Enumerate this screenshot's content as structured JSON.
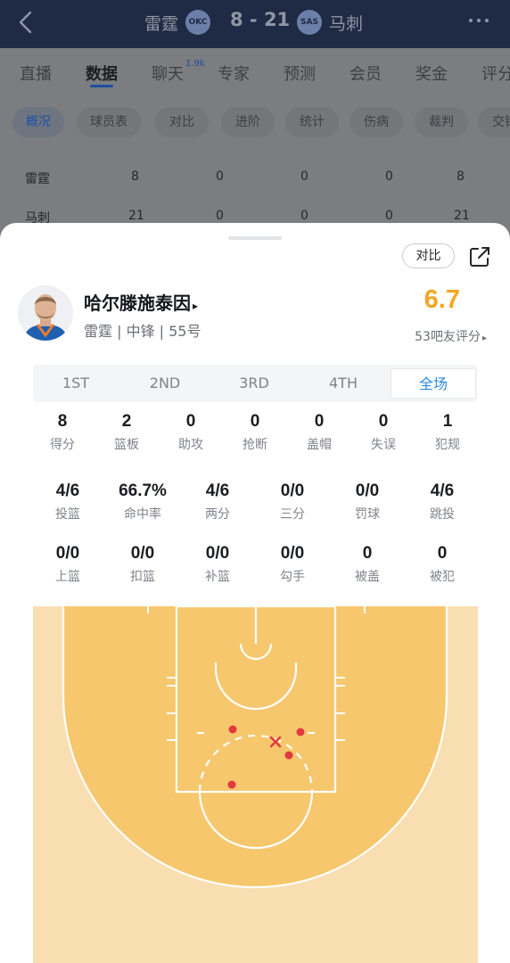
{
  "header": {
    "home_team": "雷霆",
    "home_logo": "OKC",
    "score": "8 - 21",
    "away_logo": "SAS",
    "away_team": "马刺",
    "back_icon": "back-arrow-icon",
    "more_icon": "more-dots-icon"
  },
  "main_tabs": [
    {
      "label": "直播"
    },
    {
      "label": "数据"
    },
    {
      "label": "聊天"
    },
    {
      "label": "专家"
    },
    {
      "label": "预测"
    },
    {
      "label": "会员"
    },
    {
      "label": "奖金"
    },
    {
      "label": "评分"
    }
  ],
  "chat_badge": "1.9k",
  "sub_tabs": [
    {
      "label": "概况"
    },
    {
      "label": "球员表"
    },
    {
      "label": "对比"
    },
    {
      "label": "进阶"
    },
    {
      "label": "统计"
    },
    {
      "label": "伤病"
    },
    {
      "label": "裁判"
    },
    {
      "label": "交锋"
    }
  ],
  "quarter_scores": [
    {
      "team": "雷霆",
      "q1": "8",
      "q2": "0",
      "q3": "0",
      "q4": "0",
      "total": "8"
    },
    {
      "team": "马刺",
      "q1": "21",
      "q2": "0",
      "q3": "0",
      "q4": "0",
      "total": "21"
    }
  ],
  "sheet": {
    "compare_label": "对比",
    "share_icon": "share-icon",
    "player": {
      "name": "哈尔滕施泰因",
      "name_caret": "▸",
      "meta": "雷霆 | 中锋 | 55号",
      "rating": "6.7",
      "rating_sub": "53吧友评分",
      "rating_caret": "▸"
    },
    "periods": [
      {
        "label": "1ST"
      },
      {
        "label": "2ND"
      },
      {
        "label": "3RD"
      },
      {
        "label": "4TH"
      },
      {
        "label": "全场"
      }
    ],
    "stats_row1": [
      {
        "value": "8",
        "label": "得分"
      },
      {
        "value": "2",
        "label": "篮板"
      },
      {
        "value": "0",
        "label": "助攻"
      },
      {
        "value": "0",
        "label": "抢断"
      },
      {
        "value": "0",
        "label": "盖帽"
      },
      {
        "value": "0",
        "label": "失误"
      },
      {
        "value": "1",
        "label": "犯规"
      }
    ],
    "stats_row2": [
      {
        "value": "4/6",
        "label": "投篮"
      },
      {
        "value": "66.7%",
        "label": "命中率"
      },
      {
        "value": "4/6",
        "label": "两分"
      },
      {
        "value": "0/0",
        "label": "三分"
      },
      {
        "value": "0/0",
        "label": "罚球"
      },
      {
        "value": "4/6",
        "label": "跳投"
      }
    ],
    "stats_row3": [
      {
        "value": "0/0",
        "label": "上篮"
      },
      {
        "value": "0/0",
        "label": "扣篮"
      },
      {
        "value": "0/0",
        "label": "补篮"
      },
      {
        "value": "0/0",
        "label": "勾手"
      },
      {
        "value": "0",
        "label": "被盖"
      },
      {
        "value": "0",
        "label": "被犯"
      }
    ],
    "shot_chart": {
      "made_color": "#e0393e",
      "missed_color": "#e0393e",
      "court_color": "#f6c76d",
      "court_bg": "#f8deb1",
      "made_shots": 4,
      "missed_shots": 1
    }
  }
}
